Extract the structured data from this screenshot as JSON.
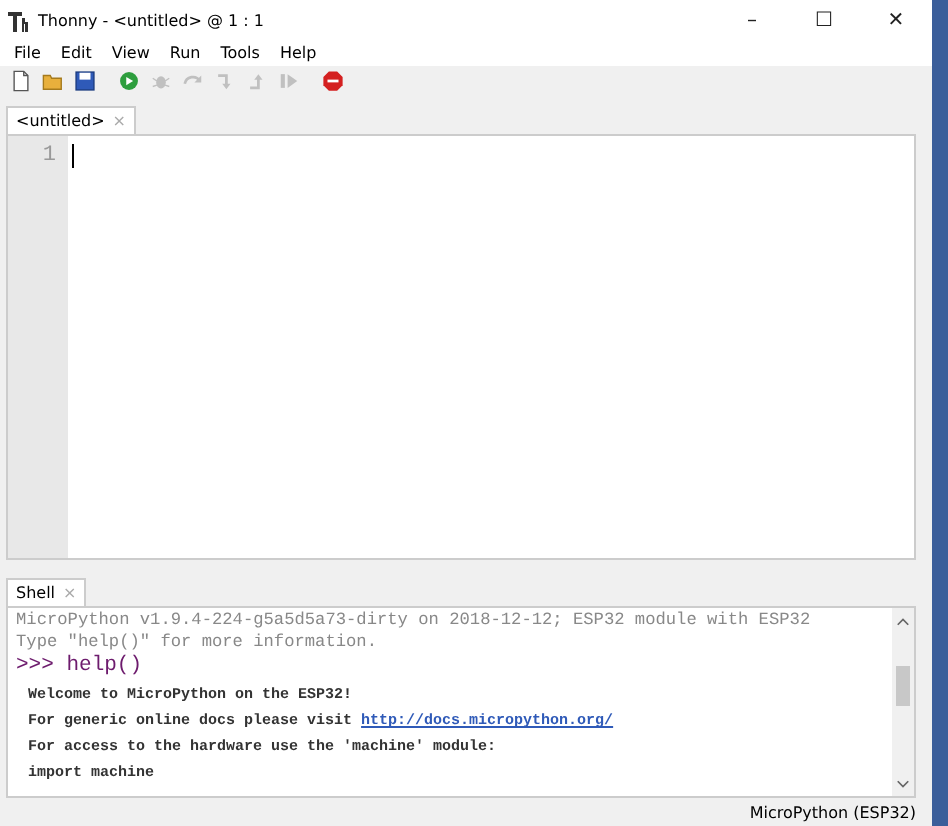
{
  "window": {
    "title": "Thonny - <untitled> @ 1 : 1",
    "controls": [
      "–",
      "☐",
      "✕"
    ]
  },
  "menu": [
    "File",
    "Edit",
    "View",
    "Run",
    "Tools",
    "Help"
  ],
  "toolbar": [
    {
      "kind": "new",
      "disabled": false
    },
    {
      "kind": "open",
      "disabled": false
    },
    {
      "kind": "save",
      "disabled": false
    },
    {
      "kind": "run",
      "disabled": false
    },
    {
      "kind": "debug",
      "disabled": true
    },
    {
      "kind": "step-over",
      "disabled": true
    },
    {
      "kind": "step-into",
      "disabled": true
    },
    {
      "kind": "step-out",
      "disabled": true
    },
    {
      "kind": "resume",
      "disabled": true
    },
    {
      "kind": "stop",
      "disabled": false
    }
  ],
  "editor": {
    "tabs": [
      {
        "label": "<untitled>",
        "close": "×",
        "selected": true
      }
    ],
    "line_numbers": [
      "1"
    ]
  },
  "shell": {
    "tab": {
      "label": "Shell",
      "close": "×"
    },
    "lines": [
      {
        "kind": "banner-cut",
        "text": "MicroPython v1.9.4-224-g5a5d5a73-dirty on 2018-12-12; ESP32 module with ESP32"
      },
      {
        "kind": "banner",
        "text": "Type \"help()\" for more information."
      },
      {
        "kind": "prompt",
        "prompt": ">>>",
        "text": "help()"
      },
      {
        "kind": "output",
        "text": "Welcome to MicroPython on the ESP32!"
      },
      {
        "kind": "output",
        "text": "For generic online docs please visit ",
        "link": "http://docs.micropython.org/"
      },
      {
        "kind": "output",
        "text": "For access to the hardware use the 'machine' module:"
      },
      {
        "kind": "output-cut",
        "text": "import machine"
      }
    ]
  },
  "status_bar": {
    "interpreter": "MicroPython (ESP32)"
  }
}
